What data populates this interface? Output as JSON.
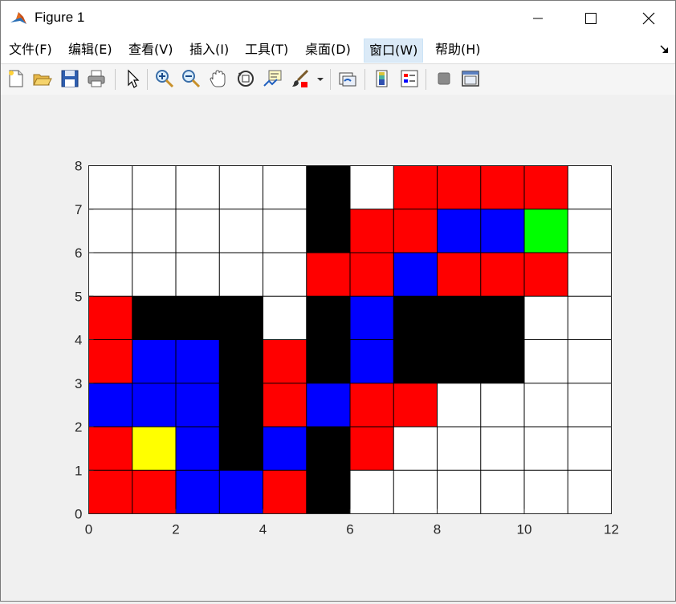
{
  "window": {
    "title": "Figure 1",
    "minimize_label": "minimize",
    "maximize_label": "maximize",
    "close_label": "close"
  },
  "menu": {
    "items": [
      {
        "id": "file",
        "label": "文件(F)"
      },
      {
        "id": "edit",
        "label": "编辑(E)"
      },
      {
        "id": "view",
        "label": "查看(V)"
      },
      {
        "id": "insert",
        "label": "插入(I)"
      },
      {
        "id": "tools",
        "label": "工具(T)"
      },
      {
        "id": "desktop",
        "label": "桌面(D)"
      },
      {
        "id": "window",
        "label": "窗口(W)"
      },
      {
        "id": "help",
        "label": "帮助(H)"
      }
    ],
    "active": "window"
  },
  "toolbar": {
    "icons": [
      "new-figure-icon",
      "open-file-icon",
      "save-icon",
      "print-icon",
      "select-arrow-icon",
      "zoom-in-icon",
      "zoom-out-icon",
      "pan-hand-icon",
      "rotate-3d-icon",
      "data-cursor-icon",
      "brush-icon",
      "brush-dropdown-icon",
      "link-plot-icon",
      "colorbar-icon",
      "legend-icon",
      "hide-plot-tools-icon",
      "show-plot-tools-icon"
    ]
  },
  "colors": {
    "white": "#ffffff",
    "black": "#000000",
    "red": "#ff0000",
    "blue": "#0000ff",
    "yellow": "#ffff00",
    "green": "#00ff00"
  },
  "chart_data": {
    "type": "heatmap",
    "title": "",
    "xlabel": "",
    "ylabel": "",
    "xlim": [
      0,
      12
    ],
    "ylim": [
      0,
      8
    ],
    "xticks": [
      "0",
      "2",
      "4",
      "6",
      "8",
      "10",
      "12"
    ],
    "yticks": [
      "0",
      "1",
      "2",
      "3",
      "4",
      "5",
      "6",
      "7",
      "8"
    ],
    "grid": true,
    "legend": "none",
    "cell_color_key": {
      "W": "white",
      "K": "black",
      "R": "red",
      "B": "blue",
      "Y": "yellow",
      "G": "green"
    },
    "rows_top_to_bottom": [
      [
        "W",
        "W",
        "W",
        "W",
        "W",
        "K",
        "W",
        "R",
        "R",
        "R",
        "R",
        "W"
      ],
      [
        "W",
        "W",
        "W",
        "W",
        "W",
        "K",
        "R",
        "R",
        "B",
        "B",
        "G",
        "W"
      ],
      [
        "W",
        "W",
        "W",
        "W",
        "W",
        "R",
        "R",
        "B",
        "R",
        "R",
        "R",
        "W"
      ],
      [
        "R",
        "K",
        "K",
        "K",
        "W",
        "K",
        "B",
        "K",
        "K",
        "K",
        "W",
        "W"
      ],
      [
        "R",
        "B",
        "B",
        "K",
        "R",
        "K",
        "B",
        "K",
        "K",
        "K",
        "W",
        "W"
      ],
      [
        "B",
        "B",
        "B",
        "K",
        "R",
        "B",
        "R",
        "R",
        "W",
        "W",
        "W",
        "W"
      ],
      [
        "R",
        "Y",
        "B",
        "K",
        "B",
        "K",
        "R",
        "W",
        "W",
        "W",
        "W",
        "W"
      ],
      [
        "R",
        "R",
        "B",
        "B",
        "R",
        "K",
        "W",
        "W",
        "W",
        "W",
        "W",
        "W"
      ]
    ]
  }
}
